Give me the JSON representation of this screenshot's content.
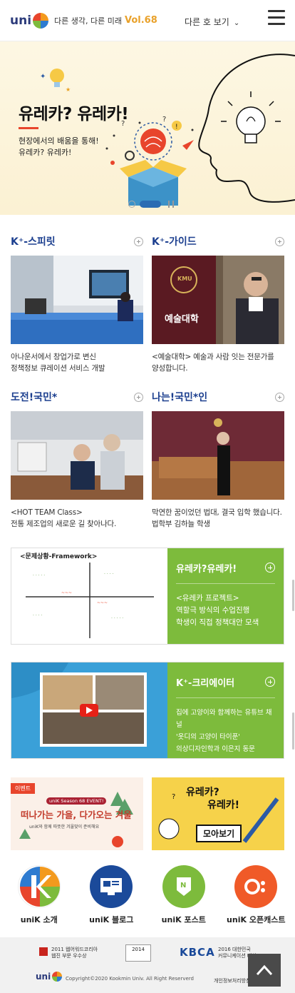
{
  "header": {
    "logo_text": "uni",
    "tagline": "다른 생각, 다른 미래",
    "volume": "Vol.68",
    "issue_select": "다른 호 보기"
  },
  "hero": {
    "title": "유레카? 유레카!",
    "subtitle_line1": "현장에서의 배움을 통해!",
    "subtitle_line2": "유레카? 유레카!"
  },
  "cards": [
    {
      "title": "K⁺-스피릿",
      "desc_line1": "아나운서에서 창업가로 변신",
      "desc_line2": "정책정보 큐레이션 서비스 개발"
    },
    {
      "title": "K⁺-가이드",
      "desc_line1": "<예술대학> 예술과 사람 잇는 전문가를",
      "desc_line2": "양성합니다.",
      "image_text": "예술대학",
      "banner_text": "KMU"
    },
    {
      "title": "도전!국민*",
      "desc_line1": "<HOT TEAM Class>",
      "desc_line2": "전통 제조업의 새로운 길 찾아나다."
    },
    {
      "title": "나는!국민*인",
      "desc_line1": "막연한 꿈이었던 법대, 결국 입학 했습니다.",
      "desc_line2": "법학부 김하늘 학생"
    }
  ],
  "banner1": {
    "title": "유레카?유레카!",
    "line1": "<유레카 프로젝트>",
    "line2": "역할극 방식의 수업진행",
    "line3": "학생이 직접 정책대안 모색",
    "sketch_title": "<문제상황-Framework>",
    "color": "#7dbb3c"
  },
  "banner2": {
    "title": "K⁺-크리에이터",
    "line1": "집에 고양이와 함께하는 유튜브 채널",
    "line2": "'옷디의 고양이 타이푼'",
    "line3": "의상디자인학과 이은지 동문",
    "color": "#7dbb3c"
  },
  "tiles": {
    "event_badge": "이벤트",
    "event_season": "uniK Season 68 EVENT!",
    "event_title": "떠나가는 가을, 다가오는 겨울",
    "event_sub": "uniK와 함께 따뜻한 겨울맞이 준비해요",
    "eureka_title1": "유레카?",
    "eureka_title2": "유레카!",
    "eureka_more": "모아보기"
  },
  "quick_links": [
    {
      "label": "uniK 소개",
      "icon": "k-logo-icon",
      "color": "#ffffff"
    },
    {
      "label": "uniK 블로그",
      "icon": "blog-icon",
      "color": "#1b4a9a"
    },
    {
      "label": "uniK 포스트",
      "icon": "post-icon",
      "color": "#7dbb3c"
    },
    {
      "label": "uniK 오픈캐스트",
      "icon": "opencast-icon",
      "color": "#f05a28"
    }
  ],
  "footer": {
    "award1_line1": "2011 웹어워드코리아",
    "award1_line2": "웹진 부문 우수상",
    "award2": "2014",
    "award3_logo": "KBCA",
    "award3_line1": "2016 대한민국",
    "award3_line2": "커뮤니케이션 대상",
    "copyright": "Copyright©2020 Kookmin Univ. All Right Reserverd",
    "privacy": "개인정보처리방침"
  }
}
